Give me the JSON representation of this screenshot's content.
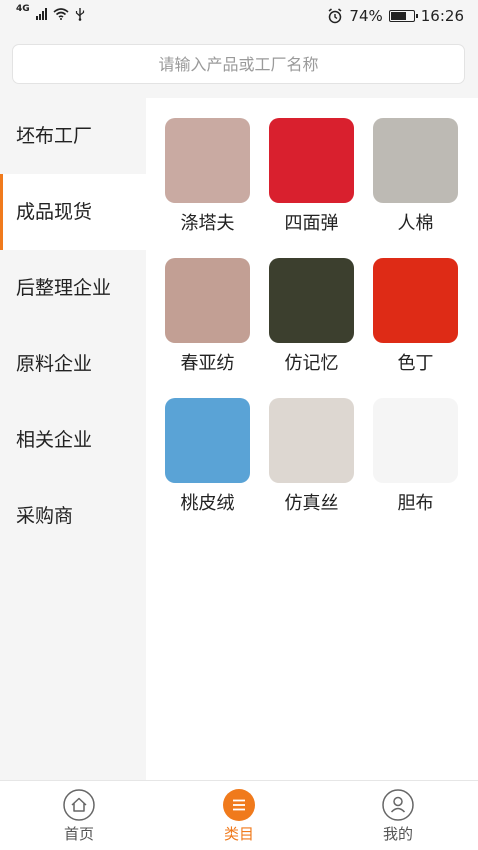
{
  "status_bar": {
    "network": "4G",
    "battery_percent": "74%",
    "battery_level": 0.74,
    "time": "16:26"
  },
  "search": {
    "placeholder": "请输入产品或工厂名称"
  },
  "sidebar": {
    "items": [
      {
        "label": "坯布工厂",
        "active": false
      },
      {
        "label": "成品现货",
        "active": true
      },
      {
        "label": "后整理企业",
        "active": false
      },
      {
        "label": "原料企业",
        "active": false
      },
      {
        "label": "相关企业",
        "active": false
      },
      {
        "label": "采购商",
        "active": false
      }
    ]
  },
  "products": [
    {
      "label": "涤塔夫",
      "color": "#c9aaa2"
    },
    {
      "label": "四面弹",
      "color": "#d9202e"
    },
    {
      "label": "人棉",
      "color": "#bdbab4"
    },
    {
      "label": "春亚纺",
      "color": "#c29f94"
    },
    {
      "label": "仿记忆",
      "color": "#3c3f2e"
    },
    {
      "label": "色丁",
      "color": "#de2b16"
    },
    {
      "label": "桃皮绒",
      "color": "#5aa3d6"
    },
    {
      "label": "仿真丝",
      "color": "#ddd7d1"
    },
    {
      "label": "胆布",
      "color": "#f5f5f5"
    }
  ],
  "tabbar": {
    "home": "首页",
    "category": "类目",
    "mine": "我的"
  },
  "colors": {
    "accent": "#f07a1c"
  }
}
